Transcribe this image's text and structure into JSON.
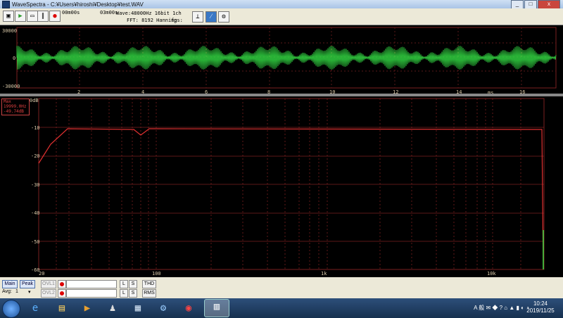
{
  "window": {
    "title": "WaveSpectra - C:¥Users¥hiroshi¥Desktop¥test.WAV",
    "min": "_",
    "max": "□",
    "close": "x"
  },
  "toolbar": {
    "time_start": "00m00s",
    "time_end": "03m00s",
    "wave_info": "Wave:48000Hz 16bit 1ch",
    "fft_info": "FFT: 8192 Hanning",
    "fps_label": "fps:"
  },
  "waveform": {
    "y_labels": [
      "30000",
      "0",
      "-30000"
    ],
    "x_labels": [
      "2",
      "4",
      "6",
      "8",
      "10",
      "12",
      "14",
      "16"
    ],
    "x_unit": "ms",
    "color": "#33dd44"
  },
  "spectrum": {
    "readout": {
      "mode": "Max",
      "freq": "19999.0Hz",
      "level": "-49.74dB"
    },
    "y_labels": [
      "0dB",
      "-10",
      "-20",
      "-30",
      "-40",
      "-50",
      "-60"
    ],
    "x_labels": [
      "20",
      "100",
      "1k",
      "10k"
    ],
    "line_color": "#e03030",
    "grid_color": "#7a2020"
  },
  "status": {
    "main": "Main",
    "peak": "Peak",
    "ovl1": "OVL1",
    "ovl2": "OVL2",
    "avg_label": "Avg:",
    "avg_value": "1",
    "l": "L",
    "s": "S",
    "thd": "THD",
    "rms": "RMS"
  },
  "taskbar": {
    "tray_text": "A 般",
    "time": "10:24",
    "date": "2019/11/25"
  }
}
